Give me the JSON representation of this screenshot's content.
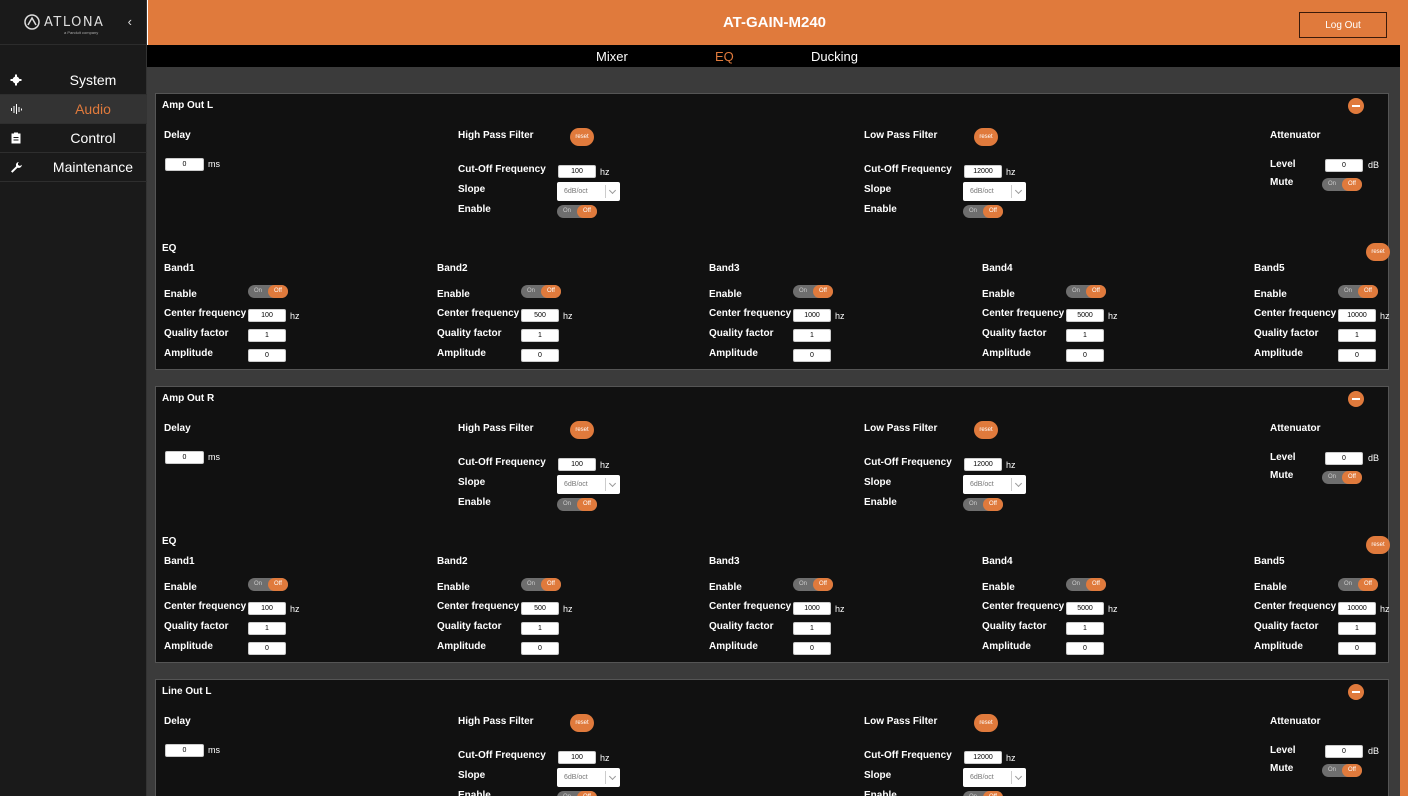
{
  "app": {
    "title": "AT-GAIN-M240",
    "logout_label": "Log Out"
  },
  "brand": {
    "name": "ATLONA",
    "sub": "a Panduit company"
  },
  "sidebar": {
    "items": [
      {
        "label": "System",
        "icon": "gear-icon",
        "active": false
      },
      {
        "label": "Audio",
        "icon": "audio-wave-icon",
        "active": true
      },
      {
        "label": "Control",
        "icon": "clipboard-icon",
        "active": false
      },
      {
        "label": "Maintenance",
        "icon": "wrench-icon",
        "active": false
      }
    ]
  },
  "tabs": [
    {
      "label": "Mixer",
      "active": false
    },
    {
      "label": "EQ",
      "active": true
    },
    {
      "label": "Ducking",
      "active": false
    }
  ],
  "labels": {
    "delay": "Delay",
    "ms": "ms",
    "hpf": "High Pass Filter",
    "lpf": "Low Pass Filter",
    "attenuator": "Attenuator",
    "cutoff": "Cut-Off Frequency",
    "slope": "Slope",
    "enable": "Enable",
    "level": "Level",
    "mute": "Mute",
    "hz": "hz",
    "db": "dB",
    "eq": "EQ",
    "center": "Center frequency",
    "quality": "Quality factor",
    "amplitude": "Amplitude",
    "reset": "reset",
    "on": "On",
    "off": "Off"
  },
  "colors": {
    "accent": "#e07a3c",
    "panel_bg": "#111111",
    "content_bg": "#3b3b3b"
  },
  "panels": [
    {
      "title": "Amp Out L",
      "delay": "0",
      "hpf": {
        "cutoff": "100",
        "slope": "6dB/oct",
        "enable": "Off"
      },
      "lpf": {
        "cutoff": "12000",
        "slope": "6dB/oct",
        "enable": "Off"
      },
      "attenuator": {
        "level": "0",
        "mute": "Off"
      },
      "bands": [
        {
          "name": "Band1",
          "enable": "Off",
          "center": "100",
          "quality": "1",
          "amplitude": "0"
        },
        {
          "name": "Band2",
          "enable": "Off",
          "center": "500",
          "quality": "1",
          "amplitude": "0"
        },
        {
          "name": "Band3",
          "enable": "Off",
          "center": "1000",
          "quality": "1",
          "amplitude": "0"
        },
        {
          "name": "Band4",
          "enable": "Off",
          "center": "5000",
          "quality": "1",
          "amplitude": "0"
        },
        {
          "name": "Band5",
          "enable": "Off",
          "center": "10000",
          "quality": "1",
          "amplitude": "0"
        }
      ]
    },
    {
      "title": "Amp Out R",
      "delay": "0",
      "hpf": {
        "cutoff": "100",
        "slope": "6dB/oct",
        "enable": "Off"
      },
      "lpf": {
        "cutoff": "12000",
        "slope": "6dB/oct",
        "enable": "Off"
      },
      "attenuator": {
        "level": "0",
        "mute": "Off"
      },
      "bands": [
        {
          "name": "Band1",
          "enable": "Off",
          "center": "100",
          "quality": "1",
          "amplitude": "0"
        },
        {
          "name": "Band2",
          "enable": "Off",
          "center": "500",
          "quality": "1",
          "amplitude": "0"
        },
        {
          "name": "Band3",
          "enable": "Off",
          "center": "1000",
          "quality": "1",
          "amplitude": "0"
        },
        {
          "name": "Band4",
          "enable": "Off",
          "center": "5000",
          "quality": "1",
          "amplitude": "0"
        },
        {
          "name": "Band5",
          "enable": "Off",
          "center": "10000",
          "quality": "1",
          "amplitude": "0"
        }
      ]
    },
    {
      "title": "Line Out L",
      "delay": "0",
      "hpf": {
        "cutoff": "100",
        "slope": "6dB/oct",
        "enable": "Off"
      },
      "lpf": {
        "cutoff": "12000",
        "slope": "6dB/oct",
        "enable": "Off"
      },
      "attenuator": {
        "level": "0",
        "mute": "Off"
      }
    }
  ]
}
